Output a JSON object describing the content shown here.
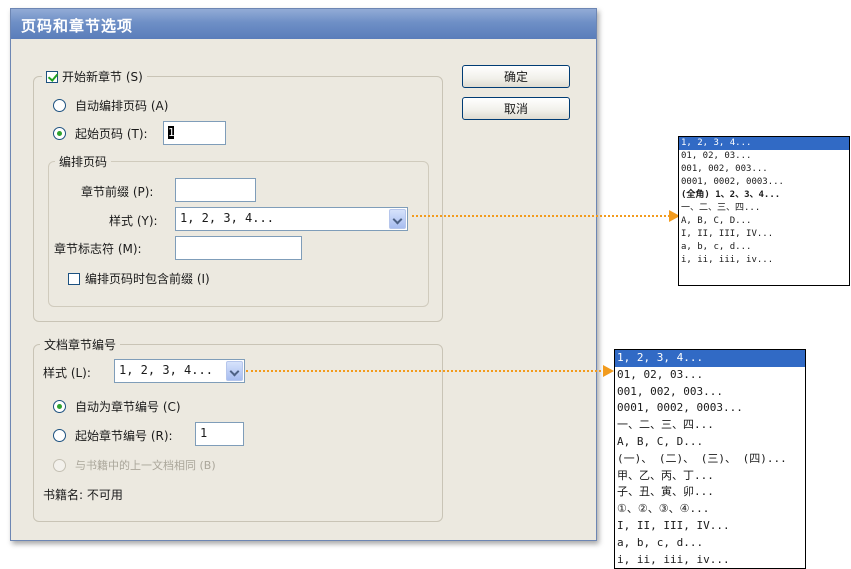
{
  "dialog": {
    "title": "页码和章节选项",
    "buttons": {
      "ok": "确定",
      "cancel": "取消"
    },
    "start_section": {
      "checkbox_label": "开始新章节 (S)",
      "checked": true,
      "auto_page_label": "自动编排页码 (A)",
      "start_page_label": "起始页码 (T):",
      "start_page_value": "1",
      "page_numbering": {
        "legend": "编排页码",
        "prefix_label": "章节前缀 (P):",
        "prefix_value": "",
        "style_label": "样式 (Y):",
        "style_value": "1, 2, 3, 4...",
        "marker_label": "章节标志符 (M):",
        "marker_value": "",
        "include_prefix_label": "编排页码时包含前缀 (I)",
        "include_prefix_checked": false
      }
    },
    "doc_chapter": {
      "legend": "文档章节编号",
      "style_label": "样式 (L):",
      "style_value": "1, 2, 3, 4...",
      "auto_chapter_label": "自动为章节编号 (C)",
      "start_chapter_label": "起始章节编号 (R):",
      "start_chapter_value": "1",
      "same_as_prev_label": "与书籍中的上一文档相同 (B)",
      "book_name_label": "书籍名: 不可用"
    }
  },
  "page_style_options": [
    "1, 2, 3, 4...",
    "01, 02, 03...",
    "001, 002, 003...",
    "0001, 0002, 0003...",
    "(全角) 1、2、3、4...",
    "一、二、三、四...",
    "A, B, C, D...",
    "I, II, III, IV...",
    "a, b, c, d...",
    "i, ii, iii, iv..."
  ],
  "chapter_style_options": [
    "1, 2, 3, 4...",
    "01, 02, 03...",
    "001, 002, 003...",
    "0001, 0002, 0003...",
    "一、二、三、四...",
    "A, B, C, D...",
    "(一)、 (二)、 (三)、 (四)...",
    "甲、乙、丙、丁...",
    "子、丑、寅、卯...",
    "①、②、③、④...",
    "I, II, III, IV...",
    "a, b, c, d...",
    "i, ii, iii, iv..."
  ],
  "colors": {
    "accent": "#f29b1d",
    "selection": "#316ac5",
    "titlebar": "#6e8fc6"
  }
}
